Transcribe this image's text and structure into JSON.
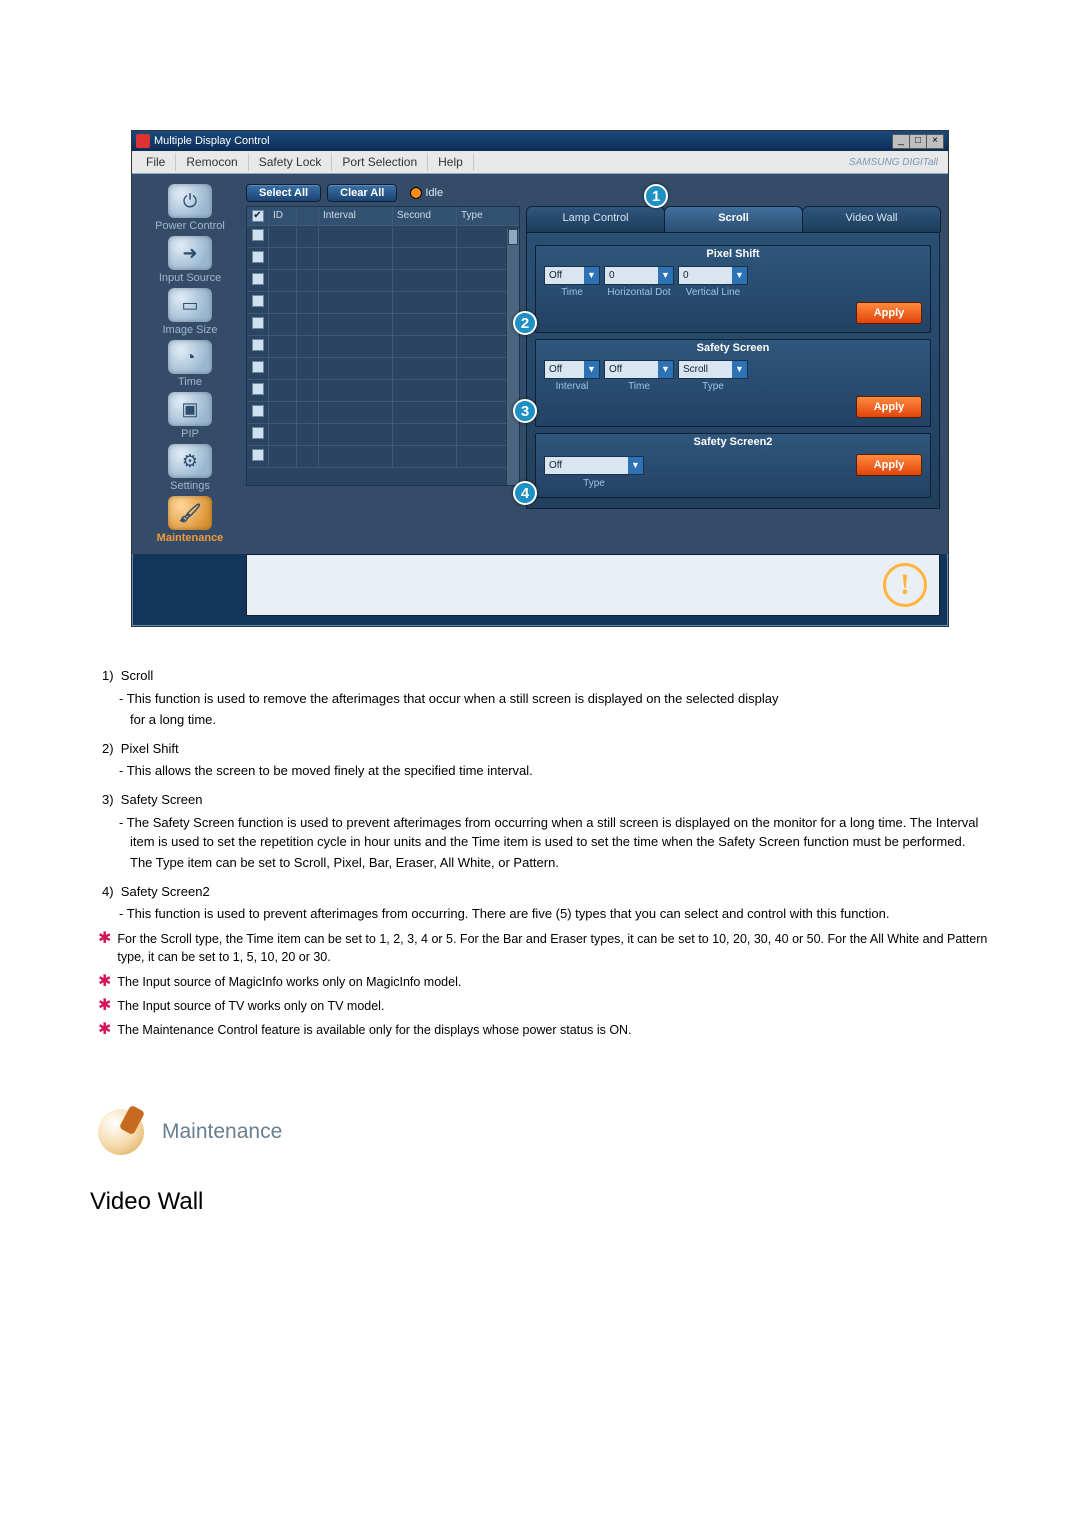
{
  "window": {
    "title": "Multiple Display Control",
    "win_min": "_",
    "win_max": "□",
    "win_close": "×"
  },
  "menu": {
    "file": "File",
    "remocon": "Remocon",
    "safety_lock": "Safety Lock",
    "port_selection": "Port Selection",
    "help": "Help",
    "brand": "SAMSUNG DIGITall"
  },
  "sidebar": {
    "items": [
      {
        "label": "Power Control",
        "glyph": "⏻"
      },
      {
        "label": "Input Source",
        "glyph": "➜"
      },
      {
        "label": "Image Size",
        "glyph": "▭"
      },
      {
        "label": "Time",
        "glyph": "◔"
      },
      {
        "label": "PIP",
        "glyph": "▣"
      },
      {
        "label": "Settings",
        "glyph": "⚙"
      },
      {
        "label": "Maintenance",
        "glyph": "🖌"
      }
    ]
  },
  "toolbar": {
    "select_all": "Select All",
    "clear_all": "Clear All",
    "idle": "Idle"
  },
  "grid": {
    "headers": {
      "id": "ID",
      "interval": "Interval",
      "second": "Second",
      "type": "Type"
    }
  },
  "tabs": {
    "lamp": "Lamp Control",
    "scroll": "Scroll",
    "video_wall": "Video Wall"
  },
  "callouts": {
    "one": "1",
    "two": "2",
    "three": "3",
    "four": "4"
  },
  "pixel_shift": {
    "title": "Pixel Shift",
    "time_val": "Off",
    "hdot_val": "0",
    "vline_val": "0",
    "time_lbl": "Time",
    "hdot_lbl": "Horizontal Dot",
    "vline_lbl": "Vertical Line",
    "apply": "Apply"
  },
  "safety_screen": {
    "title": "Safety Screen",
    "interval_val": "Off",
    "time_val": "Off",
    "type_val": "Scroll",
    "interval_lbl": "Interval",
    "time_lbl": "Time",
    "type_lbl": "Type",
    "apply": "Apply"
  },
  "safety_screen2": {
    "title": "Safety Screen2",
    "type_val": "Off",
    "type_lbl": "Type",
    "apply": "Apply"
  },
  "doc": {
    "items": [
      {
        "num": "1)",
        "title": "Scroll",
        "lines": [
          "- This function is used to remove the afterimages that occur when a still screen is displayed on the selected display",
          "for a long time."
        ]
      },
      {
        "num": "2)",
        "title": "Pixel Shift",
        "lines": [
          "- This allows the screen to be moved finely at the specified time interval."
        ]
      },
      {
        "num": "3)",
        "title": "Safety Screen",
        "lines": [
          "- The Safety Screen function is used to prevent afterimages from occurring when a still screen is displayed on the monitor for a long time.  The Interval item is used to set the repetition cycle in hour units and the Time item is used to set the time when the Safety Screen function must be performed.",
          "The Type item can be set to Scroll, Pixel, Bar, Eraser, All White, or Pattern."
        ]
      },
      {
        "num": "4)",
        "title": "Safety Screen2",
        "lines": [
          "- This function is used to prevent afterimages from occurring. There are five (5) types that you can select and control with this function."
        ]
      }
    ],
    "stars": [
      "For the Scroll type, the Time item can be set to 1, 2, 3, 4 or 5. For the Bar and Eraser types, it can be set to 10, 20, 30, 40 or 50. For the All White and Pattern type, it can be set to 1, 5, 10, 20 or 30.",
      "The Input source of MagicInfo works only on MagicInfo model.",
      "The Input source of TV works only on TV model.",
      "The Maintenance Control feature is available only for the displays whose power status is ON."
    ],
    "section_heading": "Maintenance",
    "page_sub": "Video Wall"
  }
}
